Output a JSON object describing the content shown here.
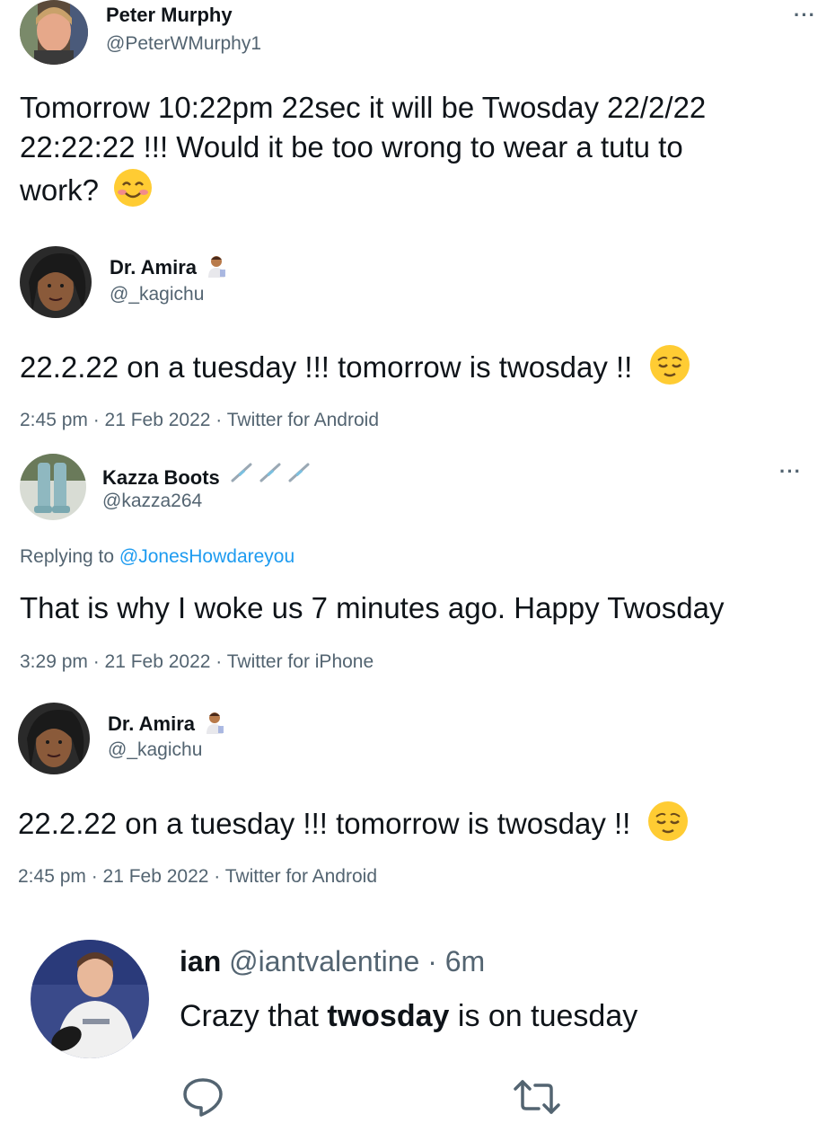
{
  "tweets": [
    {
      "name": "Peter Murphy",
      "handle": "@PeterWMurphy1",
      "more_icon": "more-icon",
      "text_line1": "Tomorrow 10:22pm 22sec it will be Twosday 22/2/22",
      "text_line2": "22:22:22 !!! Would it be too wrong to wear a tutu to",
      "text_line3": "work?",
      "emoji": "smiling-face-icon"
    },
    {
      "name": "Dr. Amira",
      "name_emoji": "scientist-icon",
      "handle": "@_kagichu",
      "text": "22.2.22 on a tuesday !!! tomorrow is twosday !!",
      "emoji": "relieved-face-icon",
      "meta": "2:45 pm · 21 Feb 2022 · Twitter for Android"
    },
    {
      "name": "Kazza Boots",
      "name_emoji": "syringe-icon",
      "handle": "@kazza264",
      "more_icon": "more-icon",
      "replying_prefix": "Replying to ",
      "replying_to": "@JonesHowdareyou",
      "text": "That is why I woke us 7 minutes ago. Happy Twosday",
      "meta": "3:29 pm · 21 Feb 2022 · Twitter for iPhone"
    },
    {
      "name": "Dr. Amira",
      "name_emoji": "scientist-icon",
      "handle": "@_kagichu",
      "text": "22.2.22 on a tuesday !!! tomorrow is twosday !!",
      "emoji": "relieved-face-icon",
      "meta": "2:45 pm · 21 Feb 2022 · Twitter for Android"
    },
    {
      "name": "ian",
      "handle": "@iantvalentine",
      "separator": "·",
      "time": "6m",
      "text_before": "Crazy that ",
      "text_bold": "twosday",
      "text_after": " is on tuesday",
      "reply_icon": "reply-icon",
      "retweet_icon": "retweet-icon"
    }
  ],
  "colors": {
    "text": "#0f1419",
    "secondary": "#536471",
    "link": "#1d9bf0"
  }
}
